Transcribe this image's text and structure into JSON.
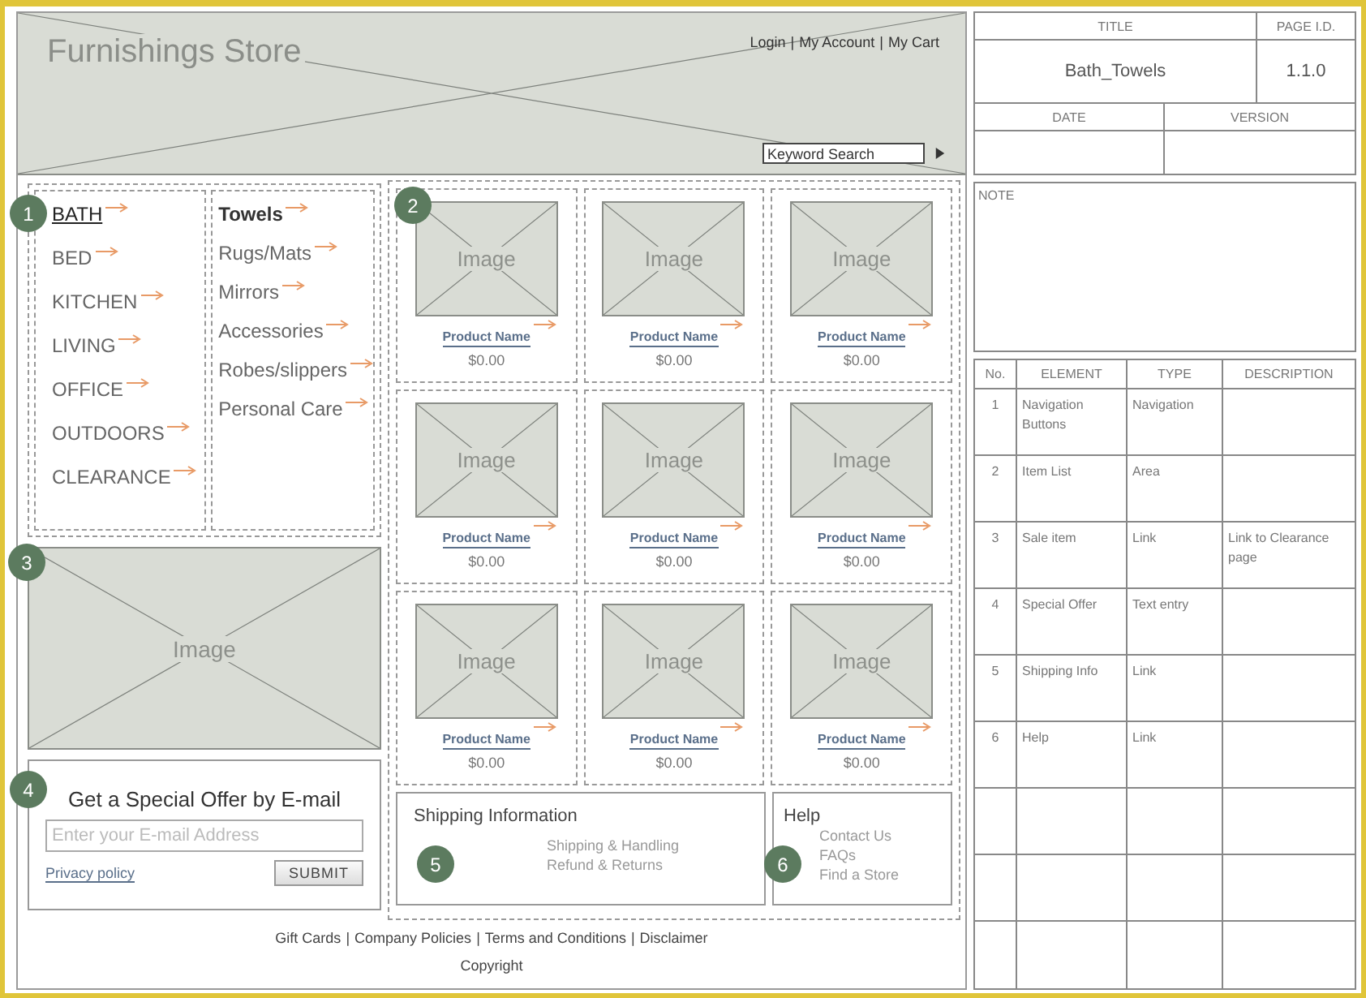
{
  "header": {
    "store_name": "Furnishings Store",
    "links": [
      "Login",
      "My Account",
      "My Cart"
    ],
    "separator": "|",
    "search": {
      "placeholder": "Keyword Search"
    }
  },
  "nav": {
    "badge": "1",
    "categories": [
      {
        "label": "BATH",
        "selected": true
      },
      {
        "label": "BED",
        "selected": false
      },
      {
        "label": "KITCHEN",
        "selected": false
      },
      {
        "label": "LIVING",
        "selected": false
      },
      {
        "label": "OFFICE",
        "selected": false
      },
      {
        "label": "OUTDOORS",
        "selected": false
      },
      {
        "label": "CLEARANCE",
        "selected": false
      }
    ],
    "subcategories": [
      {
        "label": "Towels",
        "selected": true
      },
      {
        "label": "Rugs/Mats",
        "selected": false
      },
      {
        "label": "Mirrors",
        "selected": false
      },
      {
        "label": "Accessories",
        "selected": false
      },
      {
        "label": "Robes/slippers",
        "selected": false
      },
      {
        "label": "Personal Care",
        "selected": false
      }
    ]
  },
  "promo": {
    "badge": "3",
    "image_label": "Image"
  },
  "offer": {
    "badge": "4",
    "title": "Get a Special Offer by E-mail",
    "email": {
      "placeholder": "Enter your E-mail Address"
    },
    "privacy_link": "Privacy policy",
    "submit": "SUBMIT"
  },
  "products": {
    "badge": "2",
    "items": [
      {
        "image_label": "Image",
        "name": "Product Name",
        "price": "$0.00"
      },
      {
        "image_label": "Image",
        "name": "Product Name",
        "price": "$0.00"
      },
      {
        "image_label": "Image",
        "name": "Product Name",
        "price": "$0.00"
      },
      {
        "image_label": "Image",
        "name": "Product Name",
        "price": "$0.00"
      },
      {
        "image_label": "Image",
        "name": "Product Name",
        "price": "$0.00"
      },
      {
        "image_label": "Image",
        "name": "Product Name",
        "price": "$0.00"
      },
      {
        "image_label": "Image",
        "name": "Product Name",
        "price": "$0.00"
      },
      {
        "image_label": "Image",
        "name": "Product Name",
        "price": "$0.00"
      },
      {
        "image_label": "Image",
        "name": "Product Name",
        "price": "$0.00"
      }
    ]
  },
  "shipping": {
    "badge": "5",
    "title": "Shipping Information",
    "links": [
      "Shipping & Handling",
      "Refund & Returns"
    ]
  },
  "help": {
    "badge": "6",
    "title": "Help",
    "links": [
      "Contact Us",
      "FAQs",
      "Find a Store"
    ]
  },
  "footer": {
    "links": [
      "Gift Cards",
      "Company Policies",
      "Terms and Conditions",
      "Disclaimer"
    ],
    "separator": "|",
    "copyright": "Copyright"
  },
  "title_block": {
    "title_label": "TITLE",
    "title": "Bath_Towels",
    "page_id_label": "PAGE I.D.",
    "page_id": "1.1.0",
    "date_label": "DATE",
    "version_label": "VERSION"
  },
  "note": {
    "label": "NOTE"
  },
  "elements_table": {
    "columns": [
      "No.",
      "ELEMENT",
      "TYPE",
      "DESCRIPTION"
    ],
    "rows": [
      {
        "no": "1",
        "element": "Navigation Buttons",
        "type": "Navigation"
      },
      {
        "no": "2",
        "element": "Item List",
        "type": "Area"
      },
      {
        "no": "3",
        "element": "Sale item",
        "type": "Link",
        "description": "Link to Clearance page"
      },
      {
        "no": "4",
        "element": "Special Offer",
        "type": "Text entry"
      },
      {
        "no": "5",
        "element": "Shipping Info",
        "type": "Link"
      },
      {
        "no": "6",
        "element": "Help",
        "type": "Link"
      }
    ]
  }
}
